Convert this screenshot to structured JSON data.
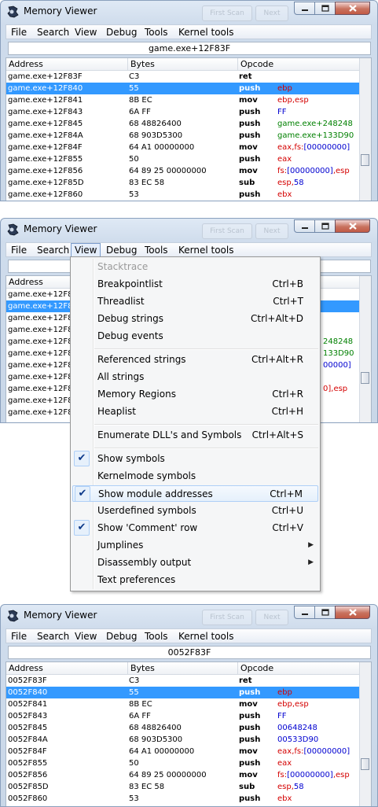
{
  "window_title": "Memory Viewer",
  "ghost_buttons": [
    "First Scan",
    "Next"
  ],
  "menu": [
    "File",
    "Search",
    "View",
    "Debug",
    "Tools",
    "Kernel tools"
  ],
  "headers": {
    "address": "Address",
    "bytes": "Bytes",
    "opcode": "Opcode"
  },
  "colors": {
    "register": "#d40000",
    "module": "#008000",
    "immediate": "#0000d0",
    "selection": "#3399ff"
  },
  "panel1": {
    "address_box": "game.exe+12F83F",
    "rows": [
      {
        "addr": "game.exe+12F83F",
        "bytes": "C3",
        "op": "ret",
        "args": []
      },
      {
        "addr": "game.exe+12F840",
        "bytes": "55",
        "op": "push",
        "args": [
          {
            "t": "ebp",
            "c": "register"
          }
        ]
      },
      {
        "addr": "game.exe+12F841",
        "bytes": "8B EC",
        "op": "mov",
        "args": [
          {
            "t": "ebp,esp",
            "c": "register"
          }
        ]
      },
      {
        "addr": "game.exe+12F843",
        "bytes": "6A FF",
        "op": "push",
        "args": [
          {
            "t": "FF",
            "c": "immediate"
          }
        ]
      },
      {
        "addr": "game.exe+12F845",
        "bytes": "68 48826400",
        "op": "push",
        "args": [
          {
            "t": "game.exe+248248",
            "c": "module"
          }
        ]
      },
      {
        "addr": "game.exe+12F84A",
        "bytes": "68 903D5300",
        "op": "push",
        "args": [
          {
            "t": "game.exe+133D90",
            "c": "module"
          }
        ]
      },
      {
        "addr": "game.exe+12F84F",
        "bytes": "64 A1 00000000",
        "op": "mov",
        "args": [
          {
            "t": "eax,fs:",
            "c": "register"
          },
          {
            "t": "[00000000]",
            "c": "immediate"
          }
        ]
      },
      {
        "addr": "game.exe+12F855",
        "bytes": "50",
        "op": "push",
        "args": [
          {
            "t": "eax",
            "c": "register"
          }
        ]
      },
      {
        "addr": "game.exe+12F856",
        "bytes": "64 89 25 00000000",
        "op": "mov",
        "args": [
          {
            "t": "fs:",
            "c": "register"
          },
          {
            "t": "[00000000]",
            "c": "immediate"
          },
          {
            "t": ",esp",
            "c": "register"
          }
        ]
      },
      {
        "addr": "game.exe+12F85D",
        "bytes": "83 EC 58",
        "op": "sub",
        "args": [
          {
            "t": "esp,",
            "c": "register"
          },
          {
            "t": "58",
            "c": "immediate"
          }
        ]
      },
      {
        "addr": "game.exe+12F860",
        "bytes": "53",
        "op": "push",
        "args": [
          {
            "t": "ebx",
            "c": "register"
          }
        ]
      }
    ]
  },
  "panel2": {
    "rows": [
      {
        "addr": "game.exe+12F83",
        "arg": ""
      },
      {
        "addr": "game.exe+12F84",
        "arg": ""
      },
      {
        "addr": "game.exe+12F84",
        "arg": ""
      },
      {
        "addr": "game.exe+12F84",
        "arg": ""
      },
      {
        "addr": "game.exe+12F84",
        "arg": "248248",
        "c": "module"
      },
      {
        "addr": "game.exe+12F84",
        "arg": "133D90",
        "c": "module"
      },
      {
        "addr": "game.exe+12F84",
        "arg": "00000]",
        "c": "immediate"
      },
      {
        "addr": "game.exe+12F85",
        "arg": ""
      },
      {
        "addr": "game.exe+12F85",
        "arg": "0],esp",
        "c": "register"
      },
      {
        "addr": "game.exe+12F85",
        "arg": ""
      },
      {
        "addr": "game.exe+12F86",
        "arg": ""
      }
    ],
    "view_menu": [
      {
        "label": "Stacktrace",
        "shortcut": "",
        "disabled": true
      },
      {
        "label": "Breakpointlist",
        "shortcut": "Ctrl+B"
      },
      {
        "label": "Threadlist",
        "shortcut": "Ctrl+T"
      },
      {
        "label": "Debug strings",
        "shortcut": "Ctrl+Alt+D"
      },
      {
        "label": "Debug events",
        "shortcut": ""
      },
      {
        "sep": true
      },
      {
        "label": "Referenced strings",
        "shortcut": "Ctrl+Alt+R"
      },
      {
        "label": "All strings",
        "shortcut": ""
      },
      {
        "label": "Memory Regions",
        "shortcut": "Ctrl+R"
      },
      {
        "label": "Heaplist",
        "shortcut": "Ctrl+H"
      },
      {
        "sep": true
      },
      {
        "label": "Enumerate DLL's and Symbols",
        "shortcut": "Ctrl+Alt+S"
      },
      {
        "sep": true
      },
      {
        "label": "Show symbols",
        "shortcut": "",
        "checked": true
      },
      {
        "label": "Kernelmode symbols",
        "shortcut": ""
      },
      {
        "label": "Show module addresses",
        "shortcut": "Ctrl+M",
        "checked": true,
        "highlighted": true
      },
      {
        "label": "Userdefined symbols",
        "shortcut": "Ctrl+U"
      },
      {
        "label": "Show 'Comment' row",
        "shortcut": "Ctrl+V",
        "checked": true
      },
      {
        "label": "Jumplines",
        "shortcut": "",
        "submenu": true
      },
      {
        "label": "Disassembly output",
        "shortcut": "",
        "submenu": true
      },
      {
        "label": "Text preferences",
        "shortcut": ""
      }
    ]
  },
  "panel3": {
    "address_box": "0052F83F",
    "rows": [
      {
        "addr": "0052F83F",
        "bytes": "C3",
        "op": "ret",
        "args": []
      },
      {
        "addr": "0052F840",
        "bytes": "55",
        "op": "push",
        "args": [
          {
            "t": "ebp",
            "c": "register"
          }
        ]
      },
      {
        "addr": "0052F841",
        "bytes": "8B EC",
        "op": "mov",
        "args": [
          {
            "t": "ebp,esp",
            "c": "register"
          }
        ]
      },
      {
        "addr": "0052F843",
        "bytes": "6A FF",
        "op": "push",
        "args": [
          {
            "t": "FF",
            "c": "immediate"
          }
        ]
      },
      {
        "addr": "0052F845",
        "bytes": "68 48826400",
        "op": "push",
        "args": [
          {
            "t": "00648248",
            "c": "immediate"
          }
        ]
      },
      {
        "addr": "0052F84A",
        "bytes": "68 903D5300",
        "op": "push",
        "args": [
          {
            "t": "00533D90",
            "c": "immediate"
          }
        ]
      },
      {
        "addr": "0052F84F",
        "bytes": "64 A1 00000000",
        "op": "mov",
        "args": [
          {
            "t": "eax,fs:",
            "c": "register"
          },
          {
            "t": "[00000000]",
            "c": "immediate"
          }
        ]
      },
      {
        "addr": "0052F855",
        "bytes": "50",
        "op": "push",
        "args": [
          {
            "t": "eax",
            "c": "register"
          }
        ]
      },
      {
        "addr": "0052F856",
        "bytes": "64 89 25 00000000",
        "op": "mov",
        "args": [
          {
            "t": "fs:",
            "c": "register"
          },
          {
            "t": "[00000000]",
            "c": "immediate"
          },
          {
            "t": ",esp",
            "c": "register"
          }
        ]
      },
      {
        "addr": "0052F85D",
        "bytes": "83 EC 58",
        "op": "sub",
        "args": [
          {
            "t": "esp,",
            "c": "register"
          },
          {
            "t": "58",
            "c": "immediate"
          }
        ]
      },
      {
        "addr": "0052F860",
        "bytes": "53",
        "op": "push",
        "args": [
          {
            "t": "ebx",
            "c": "register"
          }
        ]
      }
    ]
  }
}
